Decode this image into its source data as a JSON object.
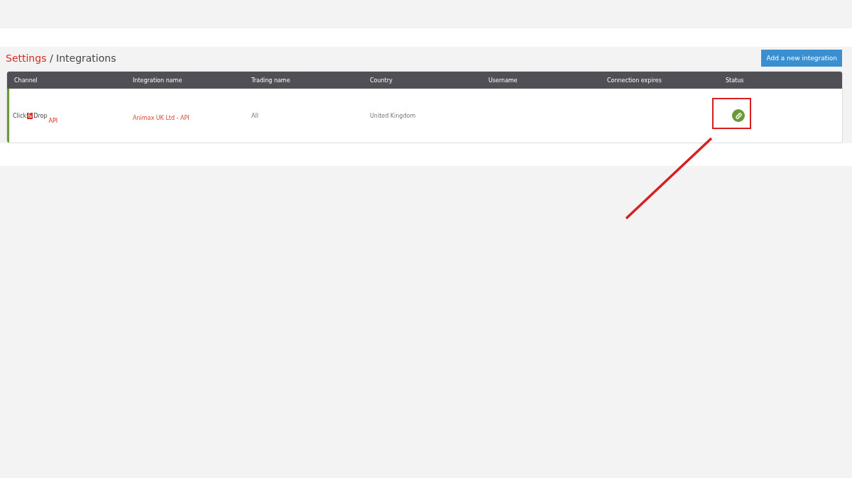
{
  "breadcrumb": {
    "parent": "Settings",
    "separator": "/",
    "current": "Integrations"
  },
  "add_button": "Add a new integration",
  "table": {
    "columns": [
      "Channel",
      "Integration name",
      "Trading name",
      "Country",
      "Username",
      "Connection expires",
      "Status"
    ],
    "rows": [
      {
        "channel_logo": {
          "word1": "Click",
          "amp": "&",
          "word2": "Drop",
          "tag": "API"
        },
        "integration_name": "Animax UK Ltd - API",
        "trading_name": "All",
        "country": "United Kingdom",
        "connected": true
      }
    ]
  }
}
